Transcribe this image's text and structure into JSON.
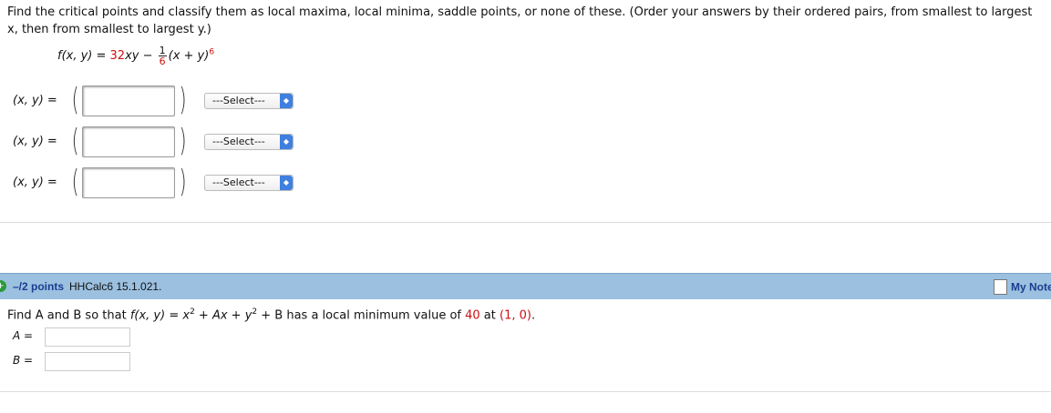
{
  "question1": {
    "instructions": "Find the critical points and classify them as local maxima, local minima, saddle points, or none of these. (Order your answers by their ordered pairs, from smallest to largest x, then from smallest to largest y.)",
    "formula": {
      "lhs": "f(x, y) = ",
      "coef": "32",
      "xy": "xy − ",
      "frac_num": "1",
      "frac_den": "6",
      "rest": "(x + y)",
      "exp": "6"
    },
    "rows": [
      {
        "label": "(x, y) =",
        "value": "",
        "select": "---Select---"
      },
      {
        "label": "(x, y) =",
        "value": "",
        "select": "---Select---"
      },
      {
        "label": "(x, y) =",
        "value": "",
        "select": "---Select---"
      }
    ]
  },
  "question2": {
    "points": "–/2 points",
    "code": "HHCalc6 15.1.021.",
    "my_notes": "My Notes",
    "text_a": "Find A and B so that ",
    "text_f": "f(x, y) = x",
    "sup2a": "2",
    "text_mid": " + Ax + y",
    "sup2b": "2",
    "text_end": " + B  has a local minimum value of ",
    "value": "40",
    "text_at": " at ",
    "point": "(1, 0)",
    "text_dot": ".",
    "inputs": [
      {
        "label": "A =",
        "value": ""
      },
      {
        "label": "B =",
        "value": ""
      }
    ]
  },
  "colors": {
    "accent_red": "#cc1111",
    "bar_bg": "#9cc0e0",
    "link_blue": "#1a3d8f"
  }
}
